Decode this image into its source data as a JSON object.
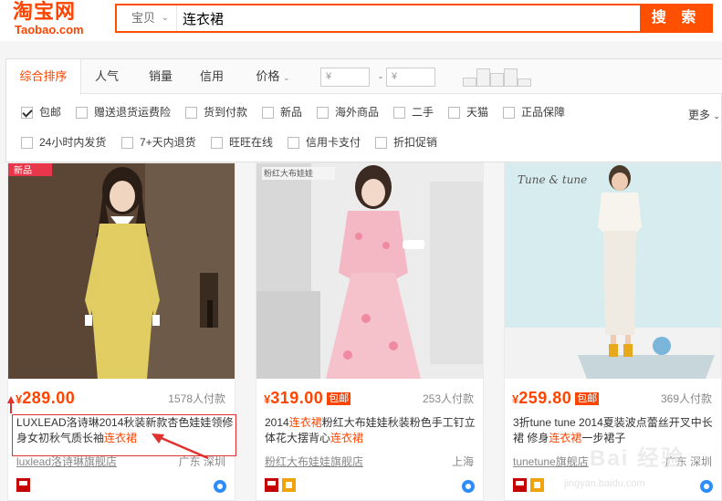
{
  "logo": {
    "main": "淘宝网",
    "sub": "Taobao.com"
  },
  "search": {
    "category": "宝贝",
    "query": "连衣裙",
    "button": "搜 索"
  },
  "sort": {
    "items": [
      "综合排序",
      "人气",
      "销量",
      "信用",
      "价格"
    ],
    "price_from_placeholder": "¥",
    "price_to_placeholder": "¥",
    "price_dash": "-"
  },
  "filters": {
    "row1": [
      {
        "label": "包邮",
        "checked": true
      },
      {
        "label": "赠送退货运费险",
        "checked": false
      },
      {
        "label": "货到付款",
        "checked": false
      },
      {
        "label": "新品",
        "checked": false
      },
      {
        "label": "海外商品",
        "checked": false
      },
      {
        "label": "二手",
        "checked": false
      },
      {
        "label": "天猫",
        "checked": false
      },
      {
        "label": "正品保障",
        "checked": false
      }
    ],
    "row2": [
      {
        "label": "24小时内发货",
        "checked": false
      },
      {
        "label": "7+天内退货",
        "checked": false
      },
      {
        "label": "旺旺在线",
        "checked": false
      },
      {
        "label": "信用卡支付",
        "checked": false
      },
      {
        "label": "折扣促销",
        "checked": false
      }
    ],
    "more": "更多"
  },
  "products": [
    {
      "yen": "¥",
      "price": "289.00",
      "tag": "",
      "paid": "1578人付款",
      "title_a": "LUXLEAD洛诗琳2014秋装新款杏色娃娃领修身女初秋气质长袖",
      "title_hl": "连衣裙",
      "title_b": "",
      "shop": "luxlead洛诗琳旗舰店",
      "location": "广东 深圳",
      "image_label": "新品"
    },
    {
      "yen": "¥",
      "price": "319.00",
      "tag": "包邮",
      "paid": "253人付款",
      "title_a": "2014",
      "title_hl": "连衣裙",
      "title_b": "粉红大布娃娃秋装粉色手工钉立体花大摆背心",
      "title_hl2": "连衣裙",
      "shop": "粉红大布娃娃旗舰店",
      "location": "上海",
      "image_label": "粉红大布娃娃 DABUWAWA"
    },
    {
      "yen": "¥",
      "price": "259.80",
      "tag": "包邮",
      "paid": "369人付款",
      "title_a": "3折tune tune 2014夏装波点蕾丝开叉中长裙 修身",
      "title_hl": "连衣裙",
      "title_b": "一步裙子",
      "shop": "tunetune旗舰店",
      "location": "广东 深圳",
      "image_label": "Tune & tune"
    }
  ],
  "watermark": {
    "main": "Bai 经验",
    "sub": "jingyan.baidu.com"
  },
  "colors": {
    "accent": "#ff4400",
    "search_border": "#ff5000",
    "annotation": "#e03030"
  }
}
